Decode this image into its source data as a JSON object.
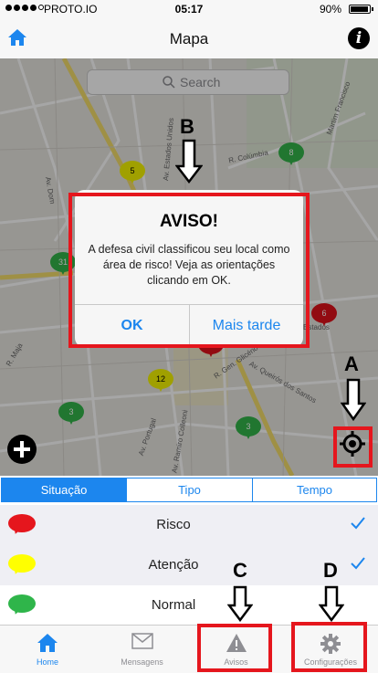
{
  "status_bar": {
    "carrier": "PROTO.IO",
    "time": "05:17",
    "battery": "90%"
  },
  "nav": {
    "title": "Mapa"
  },
  "search": {
    "placeholder": "Search"
  },
  "map_pins": [
    {
      "label": "5",
      "color": "yellow"
    },
    {
      "label": "8",
      "color": "green"
    },
    {
      "label": "31",
      "color": "green"
    },
    {
      "label": "6",
      "color": "red"
    },
    {
      "label": "12",
      "color": "yellow"
    },
    {
      "label": "3",
      "color": "green"
    },
    {
      "label": "3",
      "color": "green"
    },
    {
      "label": "",
      "color": "red"
    }
  ],
  "street_labels": [
    "R. Colúmbia",
    "Estados",
    "R. Gen. Glicério",
    "Av. Queirós dos Santos",
    "Av. Portugal",
    "Av. Ramiro Colleoni",
    "Martim Francisco",
    "Av. Estados Unidos",
    "Av. Dom",
    "R. Maja"
  ],
  "dialog": {
    "title": "AVISO!",
    "message": "A defesa civil classificou seu local como área de risco! Veja as orientações clicando em OK.",
    "ok": "OK",
    "later": "Mais tarde"
  },
  "annotations": {
    "a": "A",
    "b": "B",
    "c": "C",
    "d": "D"
  },
  "segments": [
    "Situação",
    "Tipo",
    "Tempo"
  ],
  "legend": [
    {
      "label": "Risco",
      "color": "#e5161d",
      "checked": true
    },
    {
      "label": "Atenção",
      "color": "#ffff00",
      "checked": true
    },
    {
      "label": "Normal",
      "color": "#2fb54a",
      "checked": false
    }
  ],
  "tabs": [
    {
      "label": "Home",
      "icon": "home-icon",
      "active": true
    },
    {
      "label": "Mensagens",
      "icon": "envelope-icon",
      "active": false
    },
    {
      "label": "Avisos",
      "icon": "warning-icon",
      "active": false
    },
    {
      "label": "Configurações",
      "icon": "gear-icon",
      "active": false
    }
  ],
  "colors": {
    "accent": "#1c86ee",
    "highlight": "#e5161d"
  }
}
